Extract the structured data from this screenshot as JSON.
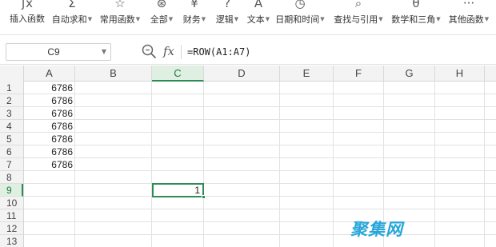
{
  "ribbon": {
    "items": [
      {
        "label": "插入函数",
        "icon": "fx-icon",
        "glyph": "ʃx",
        "has_caret": false
      },
      {
        "label": "自动求和",
        "icon": "sigma-icon",
        "glyph": "Σ",
        "has_caret": true
      },
      {
        "label": "常用函数",
        "icon": "star-icon",
        "glyph": "☆",
        "has_caret": true
      },
      {
        "label": "全部",
        "icon": "asterisk-circle-icon",
        "glyph": "⊛",
        "has_caret": true
      },
      {
        "label": "财务",
        "icon": "finance-icon",
        "glyph": "¥",
        "has_caret": true
      },
      {
        "label": "逻辑",
        "icon": "logic-icon",
        "glyph": "?",
        "has_caret": true
      },
      {
        "label": "文本",
        "icon": "text-icon",
        "glyph": "A",
        "has_caret": true
      },
      {
        "label": "日期和时间",
        "icon": "clock-icon",
        "glyph": "◷",
        "has_caret": true
      },
      {
        "label": "查找与引用",
        "icon": "lookup-icon",
        "glyph": "⌕",
        "has_caret": true
      },
      {
        "label": "数学和三角",
        "icon": "math-icon",
        "glyph": "θ",
        "has_caret": true
      },
      {
        "label": "其他函数",
        "icon": "more-icon",
        "glyph": "···",
        "has_caret": true
      }
    ]
  },
  "formula_bar": {
    "name_box": "C9",
    "fx_label": "fx",
    "formula": "=ROW(A1:A7)"
  },
  "grid": {
    "columns": [
      "A",
      "B",
      "C",
      "D",
      "E",
      "F",
      "G",
      "H"
    ],
    "active_column": "C",
    "rows": [
      "1",
      "2",
      "3",
      "4",
      "5",
      "6",
      "7",
      "8",
      "9",
      "10",
      "11",
      "12",
      "13"
    ],
    "active_row": "9",
    "column_a_values": [
      "6786",
      "6786",
      "6786",
      "6786",
      "6786",
      "6786",
      "6786"
    ],
    "selected_cell": {
      "ref": "C9",
      "value": "1"
    },
    "accent_color": "#2e8b57"
  },
  "watermark": "聚集网"
}
